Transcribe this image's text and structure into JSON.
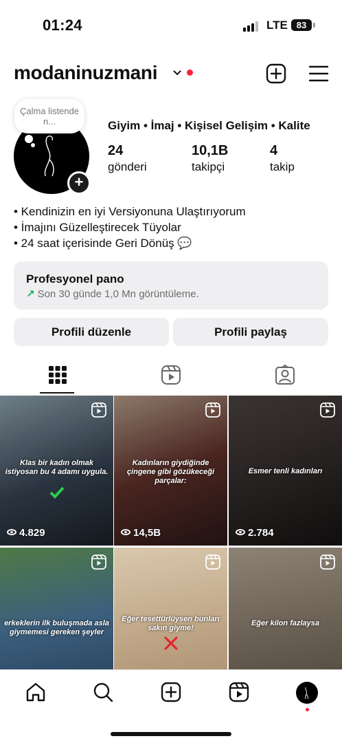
{
  "status_bar": {
    "time": "01:24",
    "network": "LTE",
    "battery": "83"
  },
  "header": {
    "username": "modaninuzmani",
    "icons": [
      "chevron-down-icon",
      "add-post-icon",
      "menu-icon"
    ],
    "accent_color": "#ff1f3a"
  },
  "profile": {
    "note_text": "Çalma listende n...",
    "category": "Giyim • İmaj • Kişisel Gelişim • Kalite",
    "stats": [
      {
        "value": "24",
        "label": "gönderi"
      },
      {
        "value": "10,1B",
        "label": "takipçi"
      },
      {
        "value": "4",
        "label": "takip"
      }
    ],
    "bio": [
      "• Kendinizin en iyi Versiyonuna Ulaştırıyorum",
      "• İmajını Güzelleştirecek Tüyolar",
      "• 24 saat içerisinde Geri Dönüş 💬"
    ]
  },
  "dashboard": {
    "title": "Profesyonel pano",
    "subtitle": "Son 30 günde 1,0 Mn görüntüleme.",
    "trend_color": "#1bae5a"
  },
  "buttons": {
    "edit": "Profili düzenle",
    "share": "Profili paylaş"
  },
  "tabs": [
    "grid-icon",
    "reels-icon",
    "tagged-icon"
  ],
  "posts": [
    {
      "caption": "Klas bir kadın olmak istiyosan bu 4 adamı uygula.",
      "views": "4.829",
      "bg": "#2f3a45"
    },
    {
      "caption": "Kadınların giydiğinde çingene gibi gözükeceği parçalar:",
      "views": "14,5B",
      "bg": "#3a1f1a"
    },
    {
      "caption": "Esmer tenli kadınları",
      "views": "2.784",
      "bg": "#2b2525"
    },
    {
      "caption": "erkeklerin ilk buluşmada asla giymemesi gereken şeyler",
      "views": "",
      "bg": "#3f5f3a"
    },
    {
      "caption": "Eğer tesettürlüysen bunları sakın giyme!",
      "views": "",
      "bg": "#cbb9a0"
    },
    {
      "caption": "Eğer kilon fazlaysa",
      "views": "",
      "bg": "#6e6357"
    }
  ],
  "nav": [
    "home-icon",
    "search-icon",
    "create-icon",
    "reels-icon",
    "profile-avatar"
  ]
}
